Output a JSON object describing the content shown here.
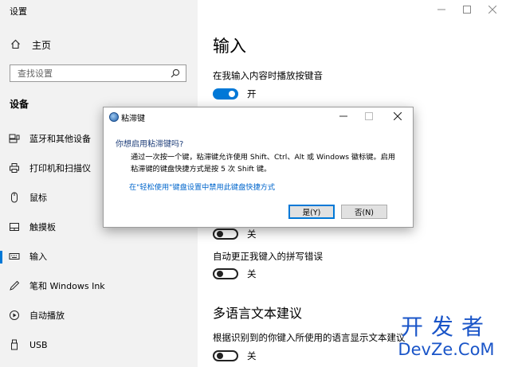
{
  "window": {
    "title": "设置"
  },
  "sidebar": {
    "home_label": "主页",
    "search_placeholder": "查找设置",
    "section_heading": "设备",
    "items": [
      {
        "label": "蓝牙和其他设备",
        "icon": "bluetooth-devices-icon"
      },
      {
        "label": "打印机和扫描仪",
        "icon": "printer-icon"
      },
      {
        "label": "鼠标",
        "icon": "mouse-icon"
      },
      {
        "label": "触摸板",
        "icon": "touchpad-icon"
      },
      {
        "label": "输入",
        "icon": "keyboard-icon",
        "selected": true
      },
      {
        "label": "笔和 Windows Ink",
        "icon": "pen-icon"
      },
      {
        "label": "自动播放",
        "icon": "autoplay-icon"
      },
      {
        "label": "USB",
        "icon": "usb-icon"
      }
    ]
  },
  "main": {
    "title": "输入",
    "settings": [
      {
        "label": "在我输入内容时播放按键音",
        "state": "开",
        "on": true
      },
      {
        "label": "",
        "state": "关",
        "on": false
      },
      {
        "label": "自动更正我键入的拼写错误",
        "state": "关",
        "on": false
      }
    ],
    "multilingual": {
      "heading": "多语言文本建议",
      "label": "根据识别到的你键入所使用的语言显示文本建议",
      "state": "关",
      "on": false
    }
  },
  "dialog": {
    "title": "粘滞键",
    "question": "你想启用粘滞键吗?",
    "body_line1": "通过一次按一个键，粘滞键允许使用 Shift、Ctrl、Alt 或 Windows 徽标键。启用",
    "body_line2": "粘滞键的键盘快捷方式是按 5 次 Shift 键。",
    "link": "在\"轻松使用\"键盘设置中禁用此键盘快捷方式",
    "yes_button": "是(Y)",
    "no_button": "否(N)"
  },
  "watermark": {
    "line1": "开发者",
    "line2": "DevZe.CoM"
  },
  "colors": {
    "accent": "#0078d7",
    "link": "#0066cc",
    "sidebar_bg": "#f2f2f2",
    "watermark": "#1a55c8"
  }
}
